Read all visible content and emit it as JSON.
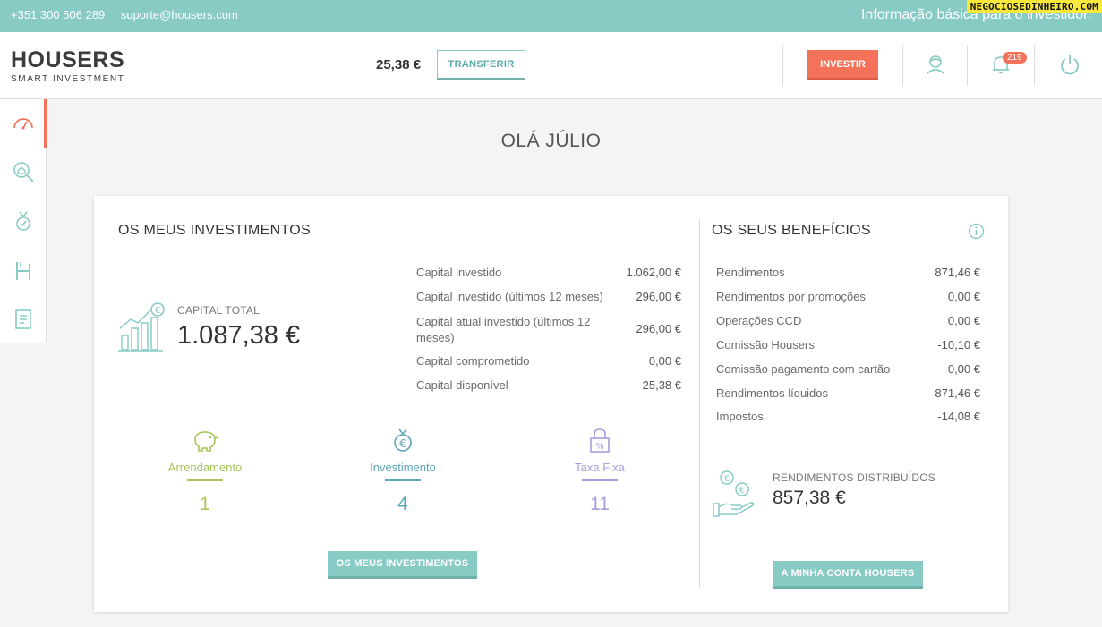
{
  "topbar": {
    "phone": "+351 300 506 289",
    "email": "suporte@housers.com",
    "info": "Informação básica para o investidor.",
    "watermark": "NEGOCIOSEDINHEIRO.COM"
  },
  "header": {
    "logo_brand": "HOUSERS",
    "logo_tag": "SMART INVESTMENT",
    "balance": "25,38 €",
    "transfer_label": "TRANSFERIR",
    "invest_label": "INVESTIR",
    "notifications_count": "219",
    "icons": [
      "user-icon",
      "bell-icon",
      "power-icon"
    ]
  },
  "sidebar": {
    "items": [
      "dashboard-gauge-icon",
      "search-house-icon",
      "medal-icon",
      "housers-h-icon",
      "document-icon"
    ]
  },
  "greeting": "OLÁ JÚLIO",
  "investments": {
    "title": "OS MEUS INVESTIMENTOS",
    "capital_total_label": "CAPITAL TOTAL",
    "capital_total_value": "1.087,38 €",
    "rows": [
      {
        "label": "Capital investido",
        "value": "1.062,00 €"
      },
      {
        "label": "Capital investido (últimos 12 meses)",
        "value": "296,00 €"
      },
      {
        "label": "Capital atual investido (últimos 12 meses)",
        "value": "296,00 €"
      },
      {
        "label": "Capital comprometido",
        "value": "0,00 €"
      },
      {
        "label": "Capital disponível",
        "value": "25,38 €"
      }
    ],
    "categories": [
      {
        "label": "Arrendamento",
        "count": "1",
        "color": "#a6c65a",
        "icon": "piggy-bank-icon"
      },
      {
        "label": "Investimento",
        "count": "4",
        "color": "#5fa6b6",
        "icon": "euro-medal-icon"
      },
      {
        "label": "Taxa Fixa",
        "count": "11",
        "color": "#a3a0dc",
        "icon": "percent-lock-icon"
      }
    ],
    "button_label": "OS MEUS INVESTIMENTOS"
  },
  "benefits": {
    "title": "OS SEUS BENEFÍCIOS",
    "rows": [
      {
        "label": "Rendimentos",
        "value": "871,46 €"
      },
      {
        "label": "Rendimentos por promoções",
        "value": "0,00 €"
      },
      {
        "label": "Operações CCD",
        "value": "0,00 €"
      },
      {
        "label": "Comissão Housers",
        "value": "-10,10 €"
      },
      {
        "label": "Comissão pagamento com cartão",
        "value": "0,00 €"
      },
      {
        "label": "Rendimentos líquidos",
        "value": "871,46 €"
      },
      {
        "label": "Impostos",
        "value": "-14,08 €"
      }
    ],
    "distributed_label": "RENDIMENTOS DISTRIBUÍDOS",
    "distributed_value": "857,38 €",
    "button_label": "A MINHA CONTA HOUSERS"
  },
  "colors": {
    "teal": "#88cbc5",
    "coral": "#f4715a"
  }
}
